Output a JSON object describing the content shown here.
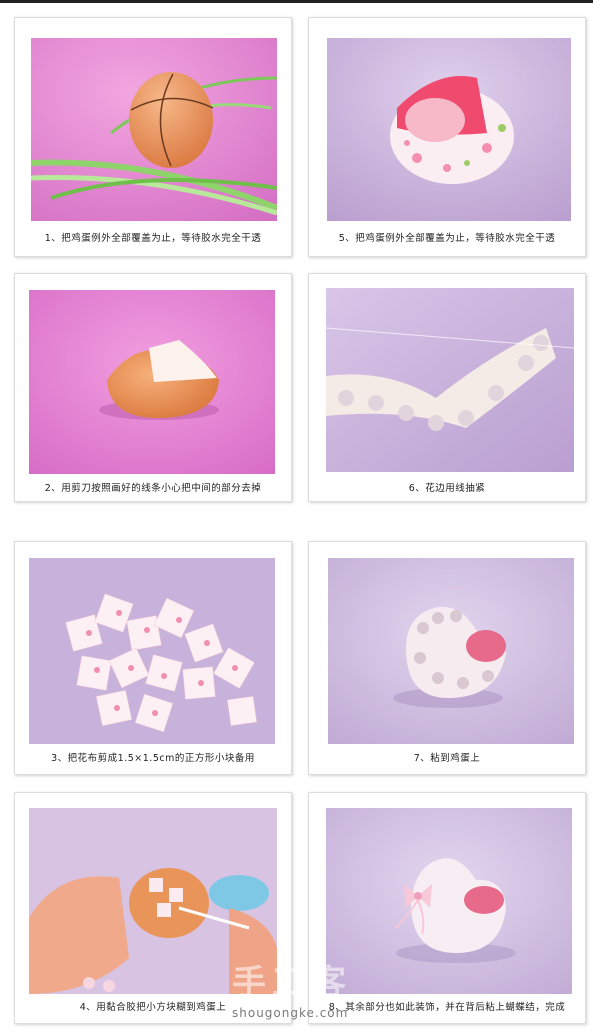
{
  "steps": [
    {
      "caption": "1、把鸡蛋例外全部覆盖为止，等待胶水完全干透"
    },
    {
      "caption": "5、把鸡蛋例外全部覆盖为止，等待胶水完全干透"
    },
    {
      "caption": "2、用剪刀按照画好的线条小心把中间的部分去掉"
    },
    {
      "caption": "6、花边用线抽紧"
    },
    {
      "caption": "3、把花布剪成1.5×1.5cm的正方形小块备用"
    },
    {
      "caption": "7、粘到鸡蛋上"
    },
    {
      "caption": "4、用黏合胶把小方块糊到鸡蛋上"
    },
    {
      "caption": "8、其余部分也如此装饰，并在背后粘上蝴蝶结，完成"
    }
  ],
  "watermark": {
    "cn": "手工客",
    "en": "shougongke.com"
  },
  "colors": {
    "pink_bg": "#e58ad0",
    "lavender_bg": "#cbb4dc",
    "egg": "#e9955a"
  }
}
